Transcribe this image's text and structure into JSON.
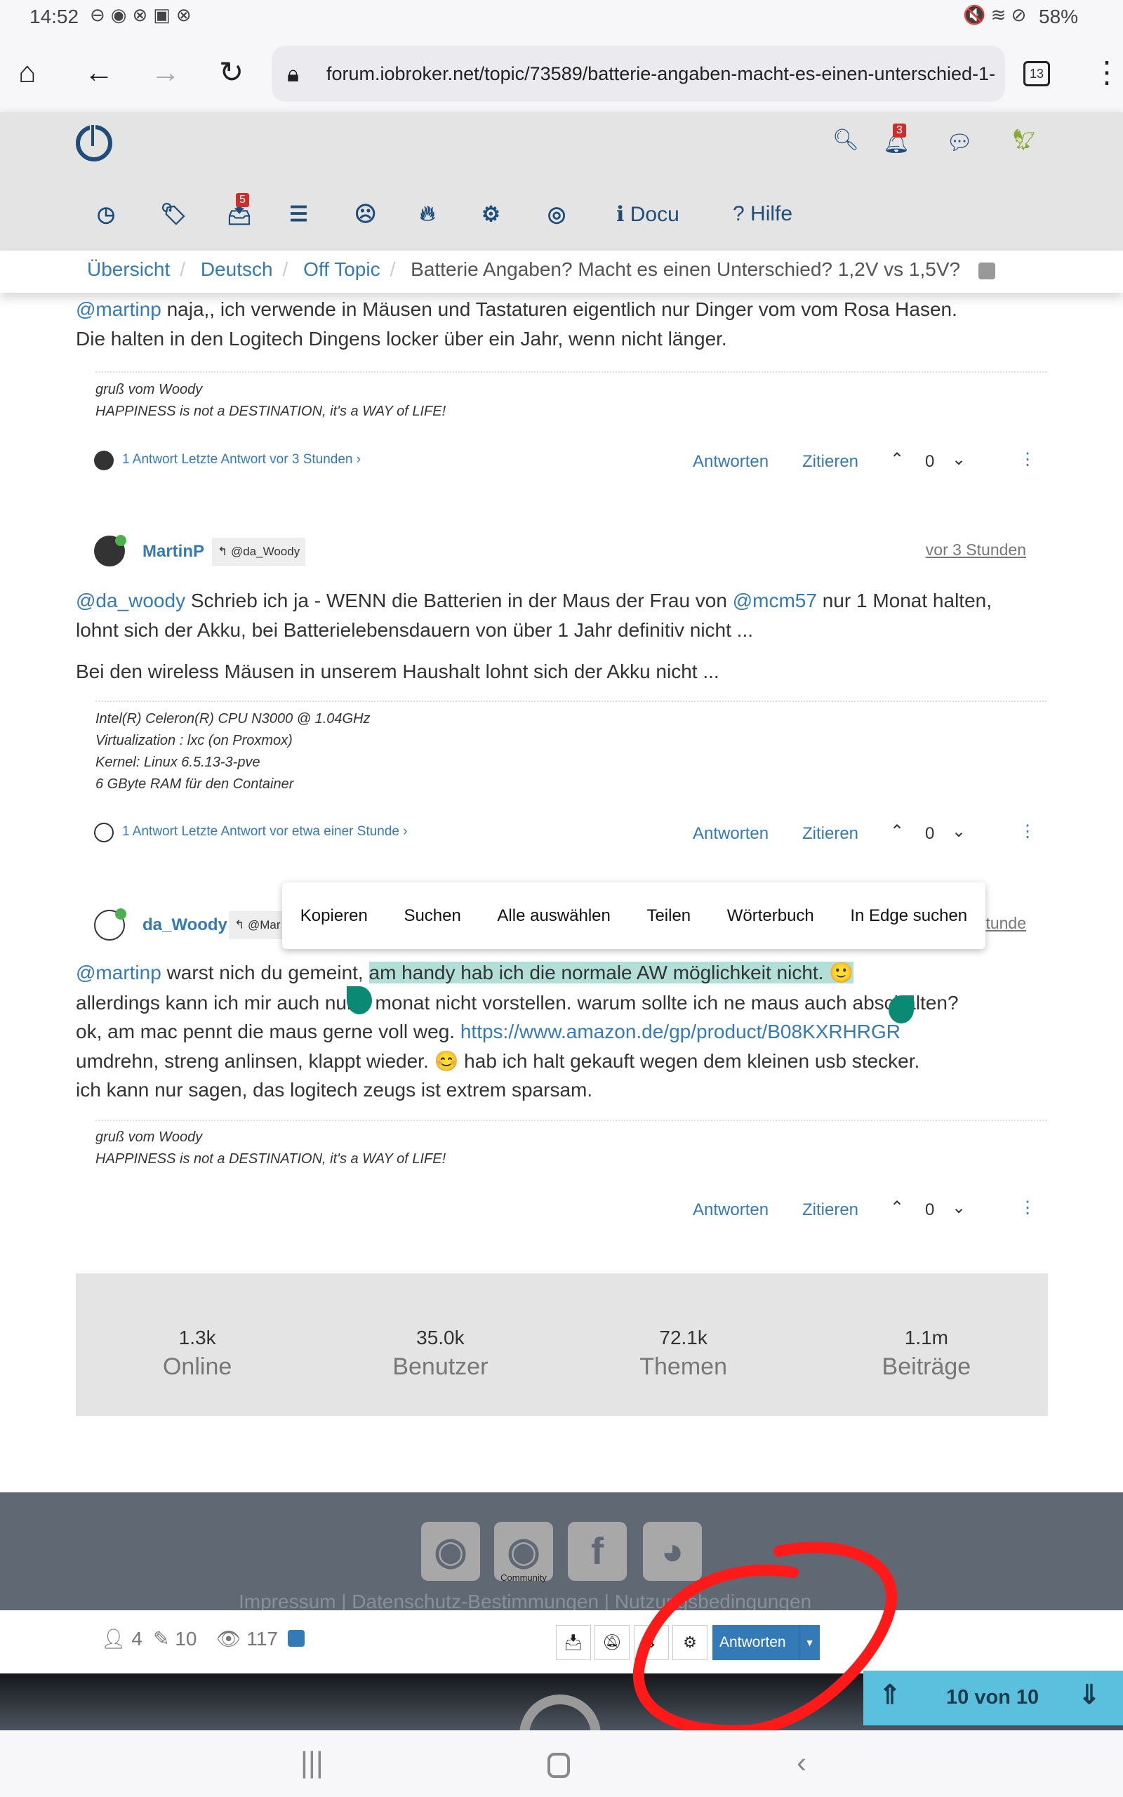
{
  "status_bar": {
    "time": "14:52",
    "battery": "58%"
  },
  "browser": {
    "url": "forum.iobroker.net/topic/73589/batterie-angaben-macht-es-einen-unterschied-1-",
    "tab_count": "13"
  },
  "header": {
    "notifications_badge": "3",
    "nav_badge": "5",
    "docu": "Docu",
    "hilfe": "Hilfe"
  },
  "breadcrumb": [
    "Übersicht",
    "Deutsch",
    "Off Topic",
    "Batterie Angaben? Macht es einen Unterschied? 1,2V vs 1,5V?"
  ],
  "posts": [
    {
      "lines": [
        {
          "mention": "@martinp",
          "text": " naja,, ich verwende in Mäusen und Tastaturen eigentlich nur Dinger vom vom Rosa Hasen."
        },
        {
          "text": "Die halten in den Logitech Dingens locker über ein Jahr, wenn nicht länger."
        }
      ],
      "signature": [
        "gruß vom Woody",
        "HAPPINESS is not a DESTINATION, it's a WAY of LIFE!"
      ],
      "replies": "1 Antwort Letzte Antwort vor 3 Stunden",
      "votes": "0"
    },
    {
      "author": "MartinP",
      "reply_to": "@da_Woody",
      "time": "vor 3 Stunden",
      "line1_mention": "@da_woody",
      "line1_text": " Schrieb ich ja - WENN die Batterien in der Maus der Frau von ",
      "line1_mention2": "@mcm57",
      "line1_rest": " nur 1 Monat halten,",
      "line2": "lohnt sich der Akku, bei Batterielebensdauern von über 1 Jahr definitiv nicht ...",
      "line3": "Bei den wireless Mäusen in unserem Haushalt lohnt sich der Akku nicht ...",
      "signature": [
        "Intel(R) Celeron(R) CPU N3000 @ 1.04GHz",
        "Virtualization : lxc (on Proxmox)",
        "Kernel: Linux 6.5.13-3-pve",
        "6 GByte RAM für den Container"
      ],
      "replies": "1 Antwort Letzte Antwort vor etwa einer Stunde",
      "votes": "0"
    },
    {
      "author": "da_Woody",
      "reply_to": "@Mar",
      "time": "tunde",
      "mention": "@martinp",
      "l1a": " warst nich du gemeint, ",
      "l1sel": "am handy hab ich die normale AW möglichkeit nicht. ",
      "l2": "allerdings kann ich mir auch nur 1 monat nicht vorstellen. warum sollte ich ne maus auch abschalten?",
      "l3": "ok, am mac pennt die maus gerne voll weg. ",
      "l3link": "https://www.amazon.de/gp/product/B08KXRHRGR",
      "l4a": "umdrehn, streng anlinsen, klappt wieder. ",
      "l4b": " hab ich halt gekauft wegen dem kleinen usb stecker.",
      "l5": "ich kann nur sagen, das logitech zeugs ist extrem sparsam.",
      "signature": [
        "gruß vom Woody",
        "HAPPINESS is not a DESTINATION, it's a WAY of LIFE!"
      ],
      "votes": "0"
    }
  ],
  "actions": {
    "reply": "Antworten",
    "quote": "Zitieren"
  },
  "context_menu": [
    "Kopieren",
    "Suchen",
    "Alle auswählen",
    "Teilen",
    "Wörterbuch",
    "In Edge suchen"
  ],
  "stats": [
    {
      "n": "1.3k",
      "l": "Online"
    },
    {
      "n": "35.0k",
      "l": "Benutzer"
    },
    {
      "n": "72.1k",
      "l": "Themen"
    },
    {
      "n": "1.1m",
      "l": "Beiträge"
    }
  ],
  "footer": {
    "community": "Community",
    "links": "Impressum  |  Datenschutz-Bestimmungen  |  Nutzungsbedingungen"
  },
  "bottom_bar": {
    "posters": "4",
    "posts": "10",
    "views": "117",
    "reply": "Antworten"
  },
  "pager": "10 von 10",
  "colors": {
    "link": "#337ab7",
    "header_bg": "#e4e4e4",
    "footer_bg": "#5f6873",
    "pager_bg": "#5bc0de",
    "annotation": "#ff1a1a"
  }
}
